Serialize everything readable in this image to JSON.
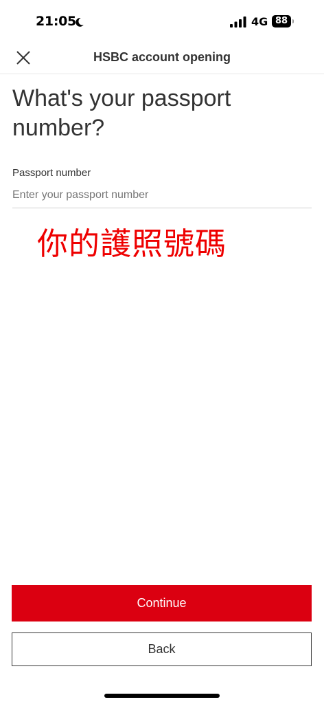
{
  "status_bar": {
    "time": "21:05",
    "network": "4G",
    "battery": "88"
  },
  "nav": {
    "title": "HSBC account opening"
  },
  "page": {
    "heading": "What's your passport number?"
  },
  "form": {
    "passport_label": "Passport number",
    "passport_placeholder": "Enter your passport number",
    "passport_value": ""
  },
  "annotation": {
    "text": "你的護照號碼",
    "color": "#ee0000"
  },
  "buttons": {
    "continue_label": "Continue",
    "back_label": "Back"
  },
  "colors": {
    "brand_red": "#db0011",
    "text": "#333333"
  }
}
